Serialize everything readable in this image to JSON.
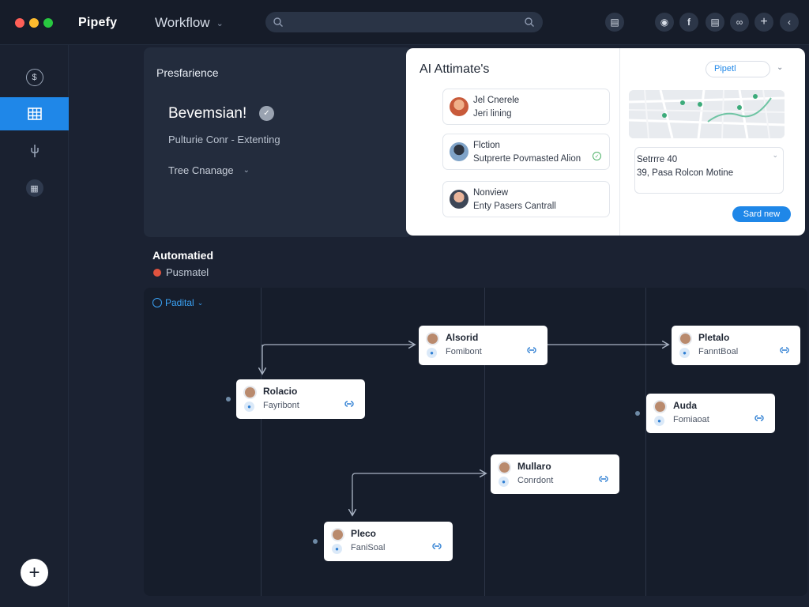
{
  "window": {
    "traffic_colors": [
      "#ff5f57",
      "#febc2e",
      "#28c840"
    ]
  },
  "header": {
    "brand": "Pipefy",
    "workflow_menu": "Workflow",
    "search_placeholder": ""
  },
  "sidebar": {
    "items": [
      {
        "icon": "dollar-icon"
      },
      {
        "icon": "grid-icon",
        "active": true
      },
      {
        "icon": "plug-icon"
      },
      {
        "icon": "calendar-icon"
      }
    ],
    "add_icon": "plus-icon"
  },
  "preferences": {
    "title": "Presfarience",
    "name": "Bevemsian!",
    "subtitle": "Pulturie Conr - Extenting",
    "change_label": "Tree Cnanage"
  },
  "ai_card": {
    "title": "AI Attimate's",
    "items": [
      {
        "line1": "Jel Cnerele",
        "line2": "Jeri lining"
      },
      {
        "line1": "Flction",
        "line2": "Sutprerte Povmasted Alion"
      },
      {
        "line1": "Nonview",
        "line2": "Enty Pasers Cantrall"
      }
    ],
    "pipe_select": "Pipetl",
    "address_line1": "Setrrre 40",
    "address_line2": "39, Pasa Rolcon Motine",
    "send_button": "Sard new"
  },
  "automated": {
    "title": "Automatied",
    "subtitle": "Pusmatel"
  },
  "board": {
    "filter_label": "Padital",
    "nodes": [
      {
        "title": "Alsorid",
        "subtitle": "Fomibont"
      },
      {
        "title": "Pletalo",
        "subtitle": "FanntBoal"
      },
      {
        "title": "Rolacio",
        "subtitle": "Fayribont"
      },
      {
        "title": "Auda",
        "subtitle": "Fomiaoat"
      },
      {
        "title": "Mullaro",
        "subtitle": "Conrdont"
      },
      {
        "title": "Pleco",
        "subtitle": "FaniSoal"
      }
    ]
  }
}
